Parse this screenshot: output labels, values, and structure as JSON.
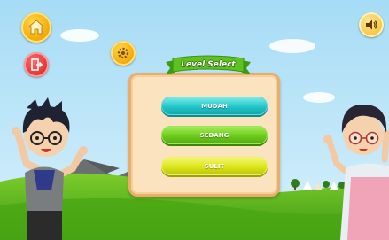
{
  "game": {
    "title": "Level Select",
    "levels": [
      {
        "label": "MUDAH",
        "color": "#22c5c8"
      },
      {
        "label": "SEDANG",
        "color": "#6dcc1d"
      },
      {
        "label": "SULIT",
        "color": "#dde51a"
      }
    ]
  },
  "buttons": {
    "home_icon": "home-icon",
    "exit_icon": "exit-icon",
    "settings_icon": "settings-gear-icon",
    "sound_icon": "speaker-icon"
  },
  "colors": {
    "sky": "#b6e3f7",
    "grass": "#5ab51e",
    "panel": "#fbe3c0",
    "panel_border": "#e9ad6c",
    "ribbon": "#4caf1c"
  }
}
